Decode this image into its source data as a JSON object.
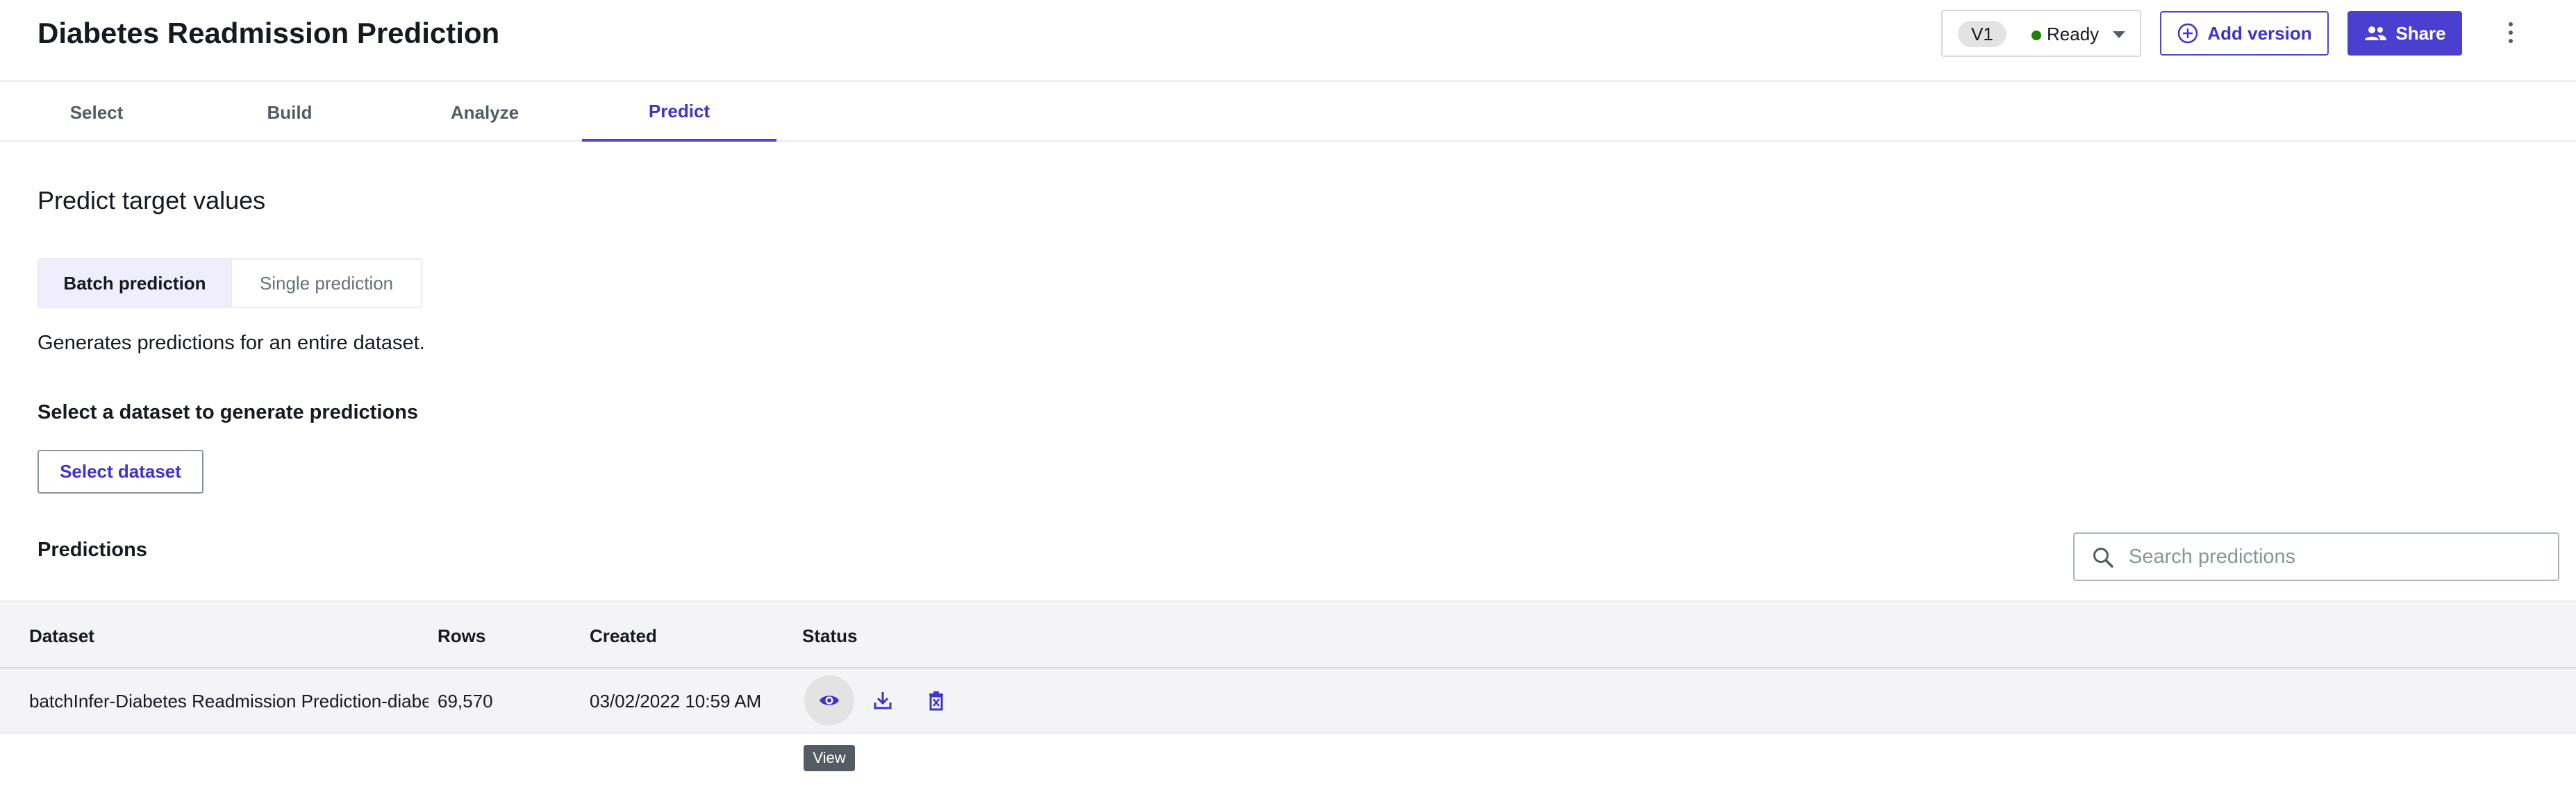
{
  "header": {
    "title": "Diabetes Readmission Prediction",
    "version_badge": "V1",
    "status_text": "Ready",
    "add_version_label": "Add version",
    "share_label": "Share"
  },
  "tabs": [
    {
      "label": "Select",
      "active": false
    },
    {
      "label": "Build",
      "active": false
    },
    {
      "label": "Analyze",
      "active": false
    },
    {
      "label": "Predict",
      "active": true
    }
  ],
  "main": {
    "section_title": "Predict target values",
    "segments": [
      {
        "label": "Batch prediction",
        "active": true
      },
      {
        "label": "Single prediction",
        "active": false
      }
    ],
    "description": "Generates predictions for an entire dataset.",
    "select_heading": "Select a dataset to generate predictions",
    "select_button": "Select dataset",
    "predictions_heading": "Predictions",
    "search_placeholder": "Search predictions"
  },
  "table": {
    "columns": [
      "Dataset",
      "Rows",
      "Created",
      "Status"
    ],
    "rows": [
      {
        "dataset": "batchInfer-Diabetes Readmission Prediction-diabeti",
        "rows": "69,570",
        "created": "03/02/2022 10:59 AM"
      }
    ],
    "tooltip": "View"
  },
  "icons": {
    "view": "eye-icon",
    "download": "download-icon",
    "delete": "delete-icon",
    "search": "search-icon",
    "add": "plus-circle-icon",
    "share": "users-icon",
    "menu": "kebab-icon",
    "dropdown": "caret-down-icon"
  },
  "colors": {
    "accent": "#5044cf",
    "accent_text": "#3f33c9",
    "status_ready": "#1d8102",
    "table_bg": "#f4f4f6"
  }
}
